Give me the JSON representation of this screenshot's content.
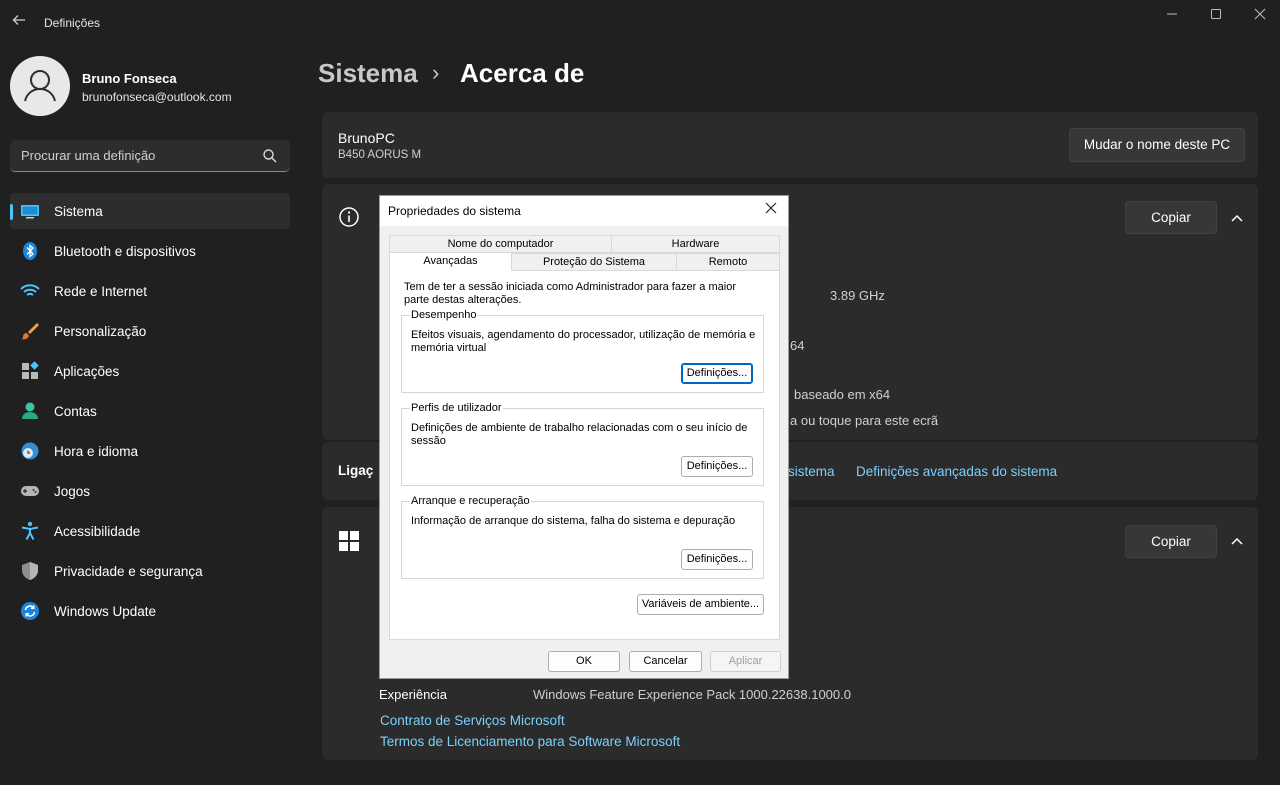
{
  "window": {
    "title": "Definições",
    "back_icon": "back-arrow-icon",
    "controls": [
      "minimize",
      "maximize",
      "close"
    ]
  },
  "profile": {
    "name": "Bruno Fonseca",
    "email": "brunofonseca@outlook.com"
  },
  "search": {
    "placeholder": "Procurar uma definição"
  },
  "nav": {
    "items": [
      {
        "label": "Sistema",
        "icon": "system-icon",
        "active": true
      },
      {
        "label": "Bluetooth e dispositivos",
        "icon": "bluetooth-icon"
      },
      {
        "label": "Rede e Internet",
        "icon": "wifi-icon"
      },
      {
        "label": "Personalização",
        "icon": "brush-icon"
      },
      {
        "label": "Aplicações",
        "icon": "apps-icon"
      },
      {
        "label": "Contas",
        "icon": "account-icon"
      },
      {
        "label": "Hora e idioma",
        "icon": "globe-clock-icon"
      },
      {
        "label": "Jogos",
        "icon": "gamepad-icon"
      },
      {
        "label": "Acessibilidade",
        "icon": "accessibility-icon"
      },
      {
        "label": "Privacidade e segurança",
        "icon": "shield-icon"
      },
      {
        "label": "Windows Update",
        "icon": "update-icon"
      }
    ]
  },
  "breadcrumb": {
    "parent": "Sistema",
    "separator": "›",
    "current": "Acerca de"
  },
  "pc_card": {
    "name": "BrunoPC",
    "model": "B450 AORUS M",
    "rename_button": "Mudar o nome deste PC"
  },
  "device_specs": {
    "copy_button": "Copiar",
    "visible_fragments": [
      "3.89 GHz",
      "64",
      "baseado em x64",
      "a ou toque para este ecrã"
    ]
  },
  "related_links": {
    "label_fragment": "Ligaç",
    "link_fragment": "sistema",
    "advanced_link": "Definições avançadas do sistema"
  },
  "windows_specs": {
    "copy_button": "Copiar",
    "experience_label": "Experiência",
    "experience_value": "Windows Feature Experience Pack 1000.22638.1000.0",
    "link_services": "Contrato de Serviços Microsoft",
    "link_license": "Termos de Licenciamento para Software Microsoft"
  },
  "dialog": {
    "title": "Propriedades do sistema",
    "tabs_row1": [
      "Nome do computador",
      "Hardware"
    ],
    "tabs_row2": [
      "Avançadas",
      "Proteção do Sistema",
      "Remoto"
    ],
    "notice": "Tem de ter a sessão iniciada como Administrador para fazer a maior parte destas alterações.",
    "groups": [
      {
        "title": "Desempenho",
        "text": "Efeitos visuais, agendamento do processador, utilização de memória e memória virtual",
        "button": "Definições..."
      },
      {
        "title": "Perfis de utilizador",
        "text": "Definições de ambiente de trabalho relacionadas com o seu início de sessão",
        "button": "Definições..."
      },
      {
        "title": "Arranque e recuperação",
        "text": "Informação de arranque do sistema, falha do sistema e depuração",
        "button": "Definições..."
      }
    ],
    "env_button": "Variáveis de ambiente...",
    "ok": "OK",
    "cancel": "Cancelar",
    "apply": "Aplicar"
  },
  "colors": {
    "background": "#202020",
    "card": "#2b2b2b",
    "accent": "#4cc2ff",
    "link": "#7bd0ff",
    "dialog": "#f0f0f0"
  }
}
